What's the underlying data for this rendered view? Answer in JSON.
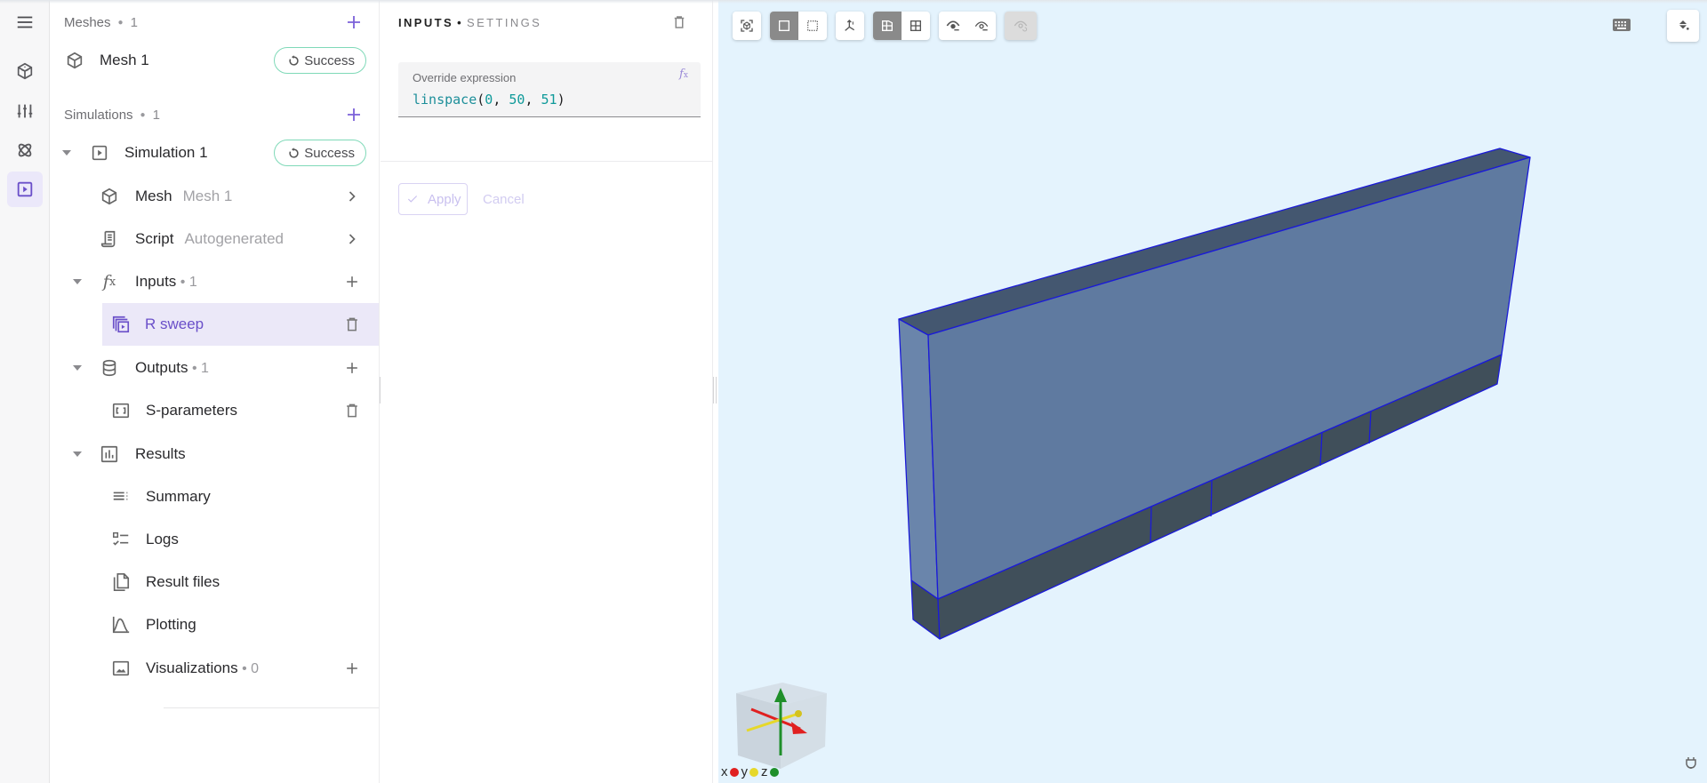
{
  "rail": {
    "items": [
      {
        "icon": "menu-icon"
      },
      {
        "icon": "geometry-icon"
      },
      {
        "icon": "sliders-icon"
      },
      {
        "icon": "atom-icon"
      },
      {
        "icon": "simulation-play-icon",
        "active": true
      }
    ]
  },
  "sidebar": {
    "meshes": {
      "title": "Meshes",
      "count": "1"
    },
    "mesh1": {
      "label": "Mesh 1",
      "status": "Success"
    },
    "simulations": {
      "title": "Simulations",
      "count": "1"
    },
    "sim1": {
      "label": "Simulation 1",
      "status": "Success"
    },
    "mesh_row": {
      "label": "Mesh",
      "value": "Mesh 1"
    },
    "script_row": {
      "label": "Script",
      "value": "Autogenerated"
    },
    "inputs": {
      "label": "Inputs",
      "count": "1"
    },
    "r_sweep": {
      "label": "R sweep"
    },
    "outputs": {
      "label": "Outputs",
      "count": "1"
    },
    "s_params": {
      "label": "S-parameters"
    },
    "results": {
      "label": "Results"
    },
    "summary": {
      "label": "Summary"
    },
    "logs": {
      "label": "Logs"
    },
    "result_files": {
      "label": "Result files"
    },
    "plotting": {
      "label": "Plotting"
    },
    "visualizations": {
      "label": "Visualizations",
      "count": "0"
    }
  },
  "panel": {
    "title_main": "INPUTS",
    "title_sep": "•",
    "title_sub": "SETTINGS",
    "expression": {
      "label": "Override expression",
      "fn": "linspace",
      "args": [
        "0",
        "50",
        "51"
      ]
    },
    "apply_label": "Apply",
    "cancel_label": "Cancel"
  },
  "viewport": {
    "toolbar": [
      {
        "icon": "fit-view-icon"
      },
      {
        "icon": "solid-select-icon",
        "active": true
      },
      {
        "icon": "box-select-icon"
      },
      {
        "icon": "axes-triad-icon"
      },
      {
        "icon": "surface-view-icon",
        "active": true
      },
      {
        "icon": "grid-view-icon"
      },
      {
        "icon": "hide-selected-icon"
      },
      {
        "icon": "show-only-icon"
      },
      {
        "icon": "show-all-icon",
        "disabled": true
      }
    ],
    "axes": {
      "x": "x",
      "y": "y",
      "z": "z"
    },
    "colors": {
      "background": "#e4f3fd",
      "face_light": "#5f7aa0",
      "face_dark": "#404f5a",
      "edge": "#1a1ad8",
      "x_axis": "#e02020",
      "y_axis": "#e6d82a",
      "z_axis": "#1f8f2a"
    }
  },
  "theme": {
    "accent": "#7b61d9",
    "success_border": "#7fd9b8"
  }
}
